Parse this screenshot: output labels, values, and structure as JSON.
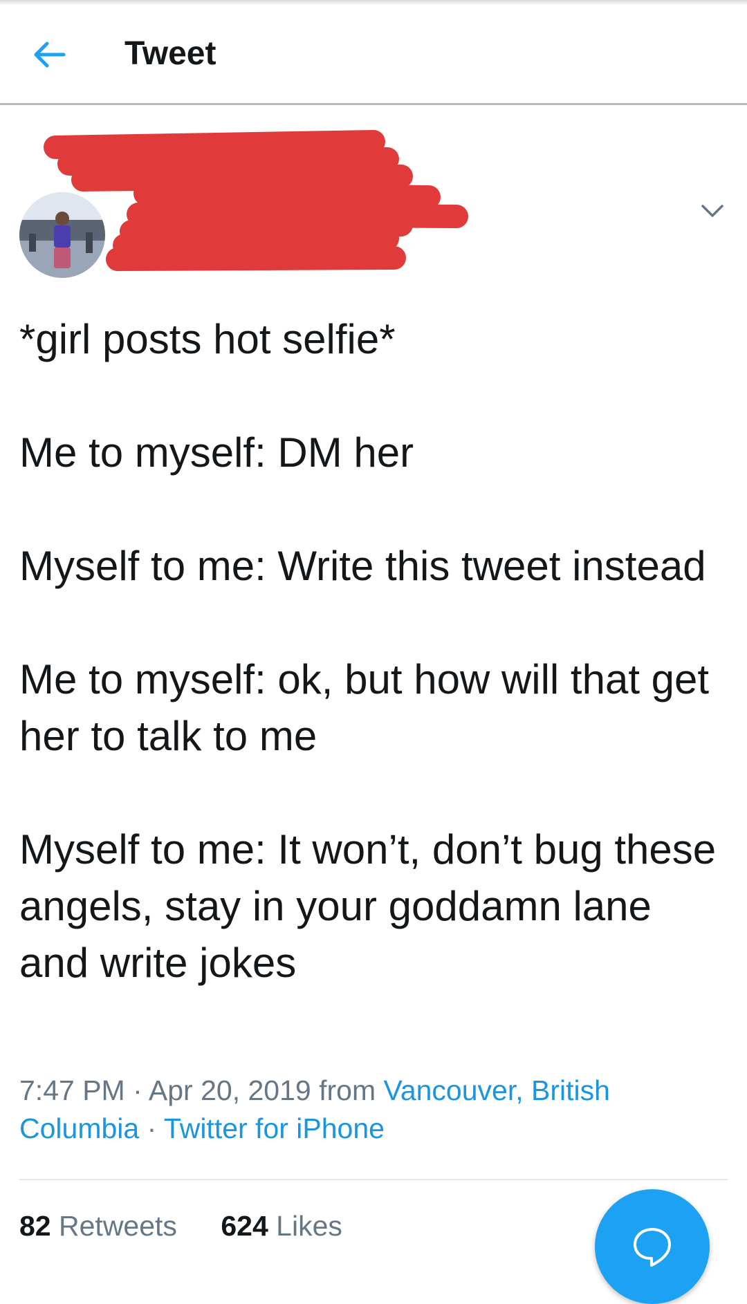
{
  "header": {
    "title": "Tweet",
    "back_icon": "arrow-left-icon"
  },
  "author": {
    "avatar": "profile-photo",
    "name": "[redacted]",
    "handle": "[redacted]"
  },
  "tweet": {
    "paragraphs": [
      "*girl posts hot selfie*",
      "Me to myself: DM her",
      "Myself to me: Write this tweet instead",
      "Me to myself: ok, but how will that get her to talk to me",
      "Myself to me: It won’t, don’t bug these angels, stay in your goddamn lane and write jokes"
    ]
  },
  "meta": {
    "time": "7:47 PM",
    "date": "Apr 20, 2019",
    "from_label": "from",
    "location": "Vancouver, British Columbia",
    "client": "Twitter for iPhone"
  },
  "stats": {
    "retweets_count": "82",
    "retweets_label": "Retweets",
    "likes_count": "624",
    "likes_label": "Likes"
  },
  "fab": {
    "icon": "compose-reply-icon"
  },
  "colors": {
    "accent": "#1da1f2",
    "link": "#1b95e0",
    "redaction": "#e03a3a"
  }
}
